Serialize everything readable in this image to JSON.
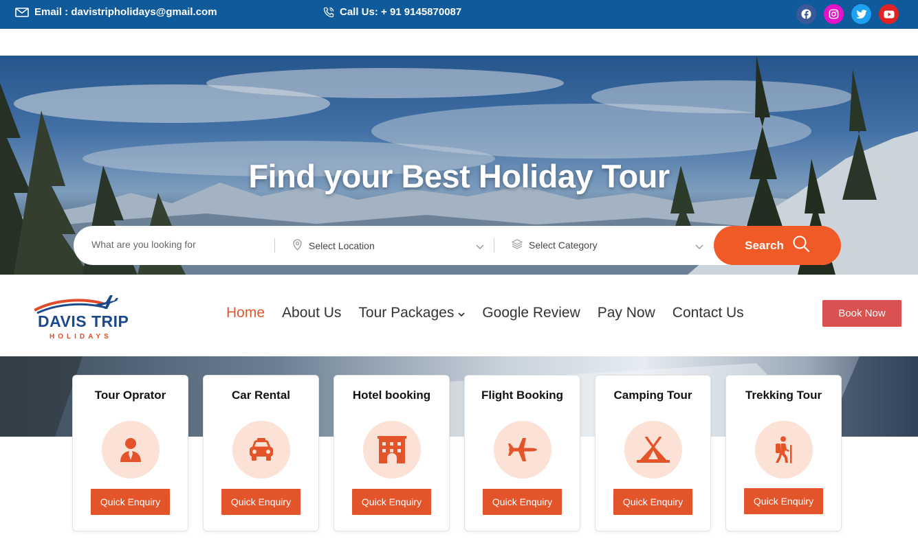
{
  "topbar": {
    "email": "Email : davistripholidays@gmail.com",
    "phone": "Call Us: + 91 9145870087",
    "socials": [
      "facebook-icon",
      "instagram-icon",
      "twitter-icon",
      "youtube-icon"
    ],
    "color": "#0e5a9a"
  },
  "hero": {
    "title": "Find your Best Holiday Tour",
    "search": {
      "placeholder": "What are you looking for",
      "location": "Select Location",
      "category": "Select Category",
      "button": "Search"
    }
  },
  "header": {
    "logo_main": "DAVIS TRIP",
    "logo_sub": "HOLIDAYS",
    "nav": [
      "Home",
      "About Us",
      "Tour Packages",
      "Google Review",
      "Pay Now",
      "Contact Us"
    ],
    "active_nav": "Home",
    "cta": "Book Now"
  },
  "services": [
    {
      "title": "Tour Oprator",
      "icon": "user-tie-icon",
      "button": "Quick Enquiry"
    },
    {
      "title": "Car Rental",
      "icon": "car-icon",
      "button": "Quick Enquiry"
    },
    {
      "title": "Hotel booking",
      "icon": "hotel-icon",
      "button": "Quick Enquiry"
    },
    {
      "title": "Flight Booking",
      "icon": "plane-icon",
      "button": "Quick Enquiry"
    },
    {
      "title": "Camping Tour",
      "icon": "tent-icon",
      "button": "Quick Enquiry"
    },
    {
      "title": "Trekking Tour",
      "icon": "hiker-icon",
      "button": "Quick Enquiry"
    }
  ],
  "colors": {
    "accent": "#ef5a27",
    "brand_blue": "#1a4a8c",
    "cta": "#d9524f"
  }
}
